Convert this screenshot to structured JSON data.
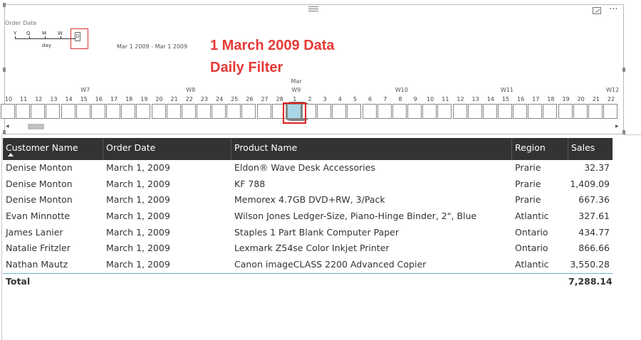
{
  "slicer": {
    "header": "Order Date",
    "granularity": {
      "letters": [
        "Y",
        "Q",
        "M",
        "W",
        "D"
      ],
      "selected": "D",
      "caption": "day"
    },
    "range_text": "Mar 1 2009 - Mar 1 2009",
    "annotation": [
      "1 March 2009 Data",
      "Daily Filter"
    ],
    "month_label": "Mar",
    "week_labels": [
      "W7",
      "W8",
      "W9",
      "W10",
      "W11",
      "W12"
    ],
    "days": [
      "10",
      "11",
      "12",
      "13",
      "14",
      "15",
      "16",
      "17",
      "18",
      "19",
      "20",
      "21",
      "22",
      "23",
      "24",
      "25",
      "26",
      "27",
      "28",
      "1",
      "2",
      "3",
      "4",
      "5",
      "6",
      "7",
      "8",
      "9",
      "10",
      "11",
      "12",
      "13",
      "14",
      "15",
      "16",
      "17",
      "18",
      "19",
      "20",
      "21",
      "22"
    ],
    "selected_day": "1",
    "icons": {
      "grip": "drag-grip-icon",
      "focus": "focus-mode-icon",
      "more": "more-options-icon"
    }
  },
  "table": {
    "columns": [
      "Customer Name",
      "Order Date",
      "Product Name",
      "Region",
      "Sales"
    ],
    "rows": [
      [
        "Denise Monton",
        "March 1, 2009",
        "Eldon® Wave Desk Accessories",
        "Prarie",
        "32.37"
      ],
      [
        "Denise Monton",
        "March 1, 2009",
        "KF 788",
        "Prarie",
        "1,409.09"
      ],
      [
        "Denise Monton",
        "March 1, 2009",
        "Memorex 4.7GB DVD+RW, 3/Pack",
        "Prarie",
        "667.36"
      ],
      [
        "Evan Minnotte",
        "March 1, 2009",
        "Wilson Jones Ledger-Size, Piano-Hinge Binder, 2\", Blue",
        "Atlantic",
        "327.61"
      ],
      [
        "James Lanier",
        "March 1, 2009",
        "Staples 1 Part Blank Computer Paper",
        "Ontario",
        "434.77"
      ],
      [
        "Natalie Fritzler",
        "March 1, 2009",
        "Lexmark Z54se Color Inkjet Printer",
        "Ontario",
        "866.66"
      ],
      [
        "Nathan Mautz",
        "March 1, 2009",
        "Canon imageCLASS 2200 Advanced Copier",
        "Atlantic",
        "3,550.28"
      ]
    ],
    "total_label": "Total",
    "total_value": "7,288.14",
    "header_bg": "#333333",
    "separator_color": "#6fb4d4"
  },
  "colors": {
    "annotation": "#e53935",
    "selected_cell": "#a9d6e6"
  }
}
